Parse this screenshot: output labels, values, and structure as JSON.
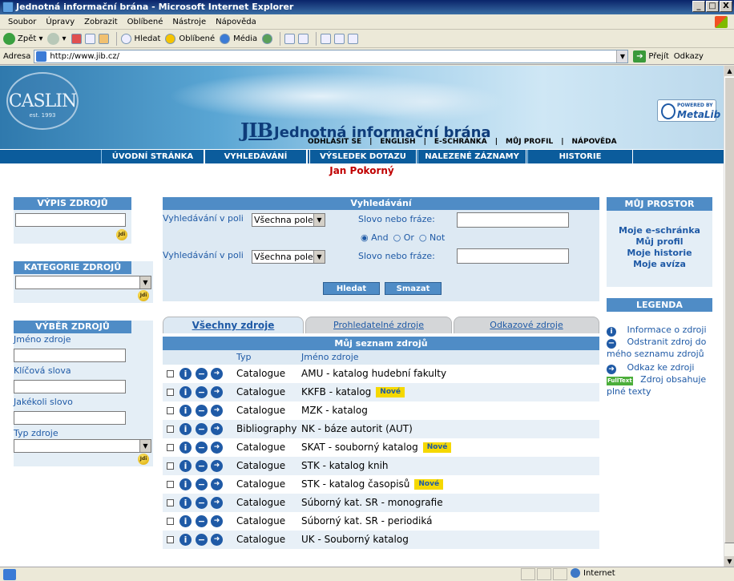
{
  "window": {
    "title": "Jednotná informační brána - Microsoft Internet Explorer",
    "buttons": [
      "_",
      "□",
      "X"
    ]
  },
  "menu": [
    "Soubor",
    "Úpravy",
    "Zobrazit",
    "Oblíbené",
    "Nástroje",
    "Nápověda"
  ],
  "toolbar": {
    "back": "Zpět",
    "search": "Hledat",
    "favorites": "Oblíbené",
    "media": "Média"
  },
  "address": {
    "label": "Adresa",
    "url": "http://www.jib.cz/",
    "go": "Přejít",
    "links": "Odkazy"
  },
  "status": {
    "zone": "Internet"
  },
  "header": {
    "caslin": "CASLIN",
    "caslin_est": "est. 1993",
    "jib": "JIB",
    "brand": "Jednotná informační brána",
    "metalib_powered": "POWERED BY",
    "metalib": "MetaLib",
    "links": [
      "ODHLÁSIT SE",
      "ENGLISH",
      "E-SCHRÁNKA",
      "MŮJ PROFIL",
      "NÁPOVĚDA"
    ]
  },
  "nav": [
    "ÚVODNÍ STRÁNKA",
    "VYHLEDÁVÁNÍ",
    "VÝSLEDEK DOTAZU",
    "NALEZENÉ ZÁZNAMY",
    "HISTORIE"
  ],
  "user": "Jan Pokorný",
  "left": {
    "vypis": {
      "title": "VÝPIS ZDROJŮ",
      "go": "Jdi"
    },
    "kategorie": {
      "title": "KATEGORIE ZDROJŮ",
      "go": "Jdi"
    },
    "vyber": {
      "title": "VÝBĚR ZDROJŮ",
      "name": "Jméno zdroje",
      "keywords": "Klíčová slova",
      "anyword": "Jakékoli slovo",
      "type": "Typ zdroje",
      "go": "Jdi"
    }
  },
  "search": {
    "title": "Vyhledávání",
    "field_label": "Vyhledávání v poli",
    "field_value": "Všechna pole",
    "phrase_label": "Slovo nebo fráze:",
    "ops": [
      "And",
      "Or",
      "Not"
    ],
    "submit": "Hledat",
    "clear": "Smazat"
  },
  "tabs": [
    "Všechny zdroje",
    "Prohledatelné zdroje",
    "Odkazové zdroje"
  ],
  "list": {
    "title": "Můj seznam zdrojů",
    "col_type": "Typ",
    "col_name": "Jméno zdroje",
    "new_badge": "Nové",
    "rows": [
      {
        "type": "Catalogue",
        "name": "AMU - katalog hudební fakulty",
        "new": false
      },
      {
        "type": "Catalogue",
        "name": "KKFB - katalog",
        "new": true
      },
      {
        "type": "Catalogue",
        "name": "MZK - katalog",
        "new": false
      },
      {
        "type": "Bibliography",
        "name": "NK - báze autorit (AUT)",
        "new": false
      },
      {
        "type": "Catalogue",
        "name": "SKAT - souborný katalog",
        "new": true
      },
      {
        "type": "Catalogue",
        "name": "STK - katalog knih",
        "new": false
      },
      {
        "type": "Catalogue",
        "name": "STK - katalog časopisů",
        "new": true
      },
      {
        "type": "Catalogue",
        "name": "Súborný kat. SR - monografie",
        "new": false
      },
      {
        "type": "Catalogue",
        "name": "Súborný kat. SR - periodiká",
        "new": false
      },
      {
        "type": "Catalogue",
        "name": "UK - Souborný katalog",
        "new": false
      }
    ]
  },
  "right": {
    "prostor": {
      "title": "MŮJ PROSTOR",
      "links": [
        "Moje e-schránka",
        "Můj profil",
        "Moje historie",
        "Moje avíza"
      ]
    },
    "legenda": {
      "title": "LEGENDA",
      "info": "Informace o zdroji",
      "remove_a": "Odstranit zdroj do",
      "remove_b": "mého seznamu zdrojů",
      "link": "Odkaz ke zdroji",
      "fulltext_icon": "FullText",
      "fulltext_a": "Zdroj obsahuje",
      "fulltext_b": "plné texty"
    }
  }
}
